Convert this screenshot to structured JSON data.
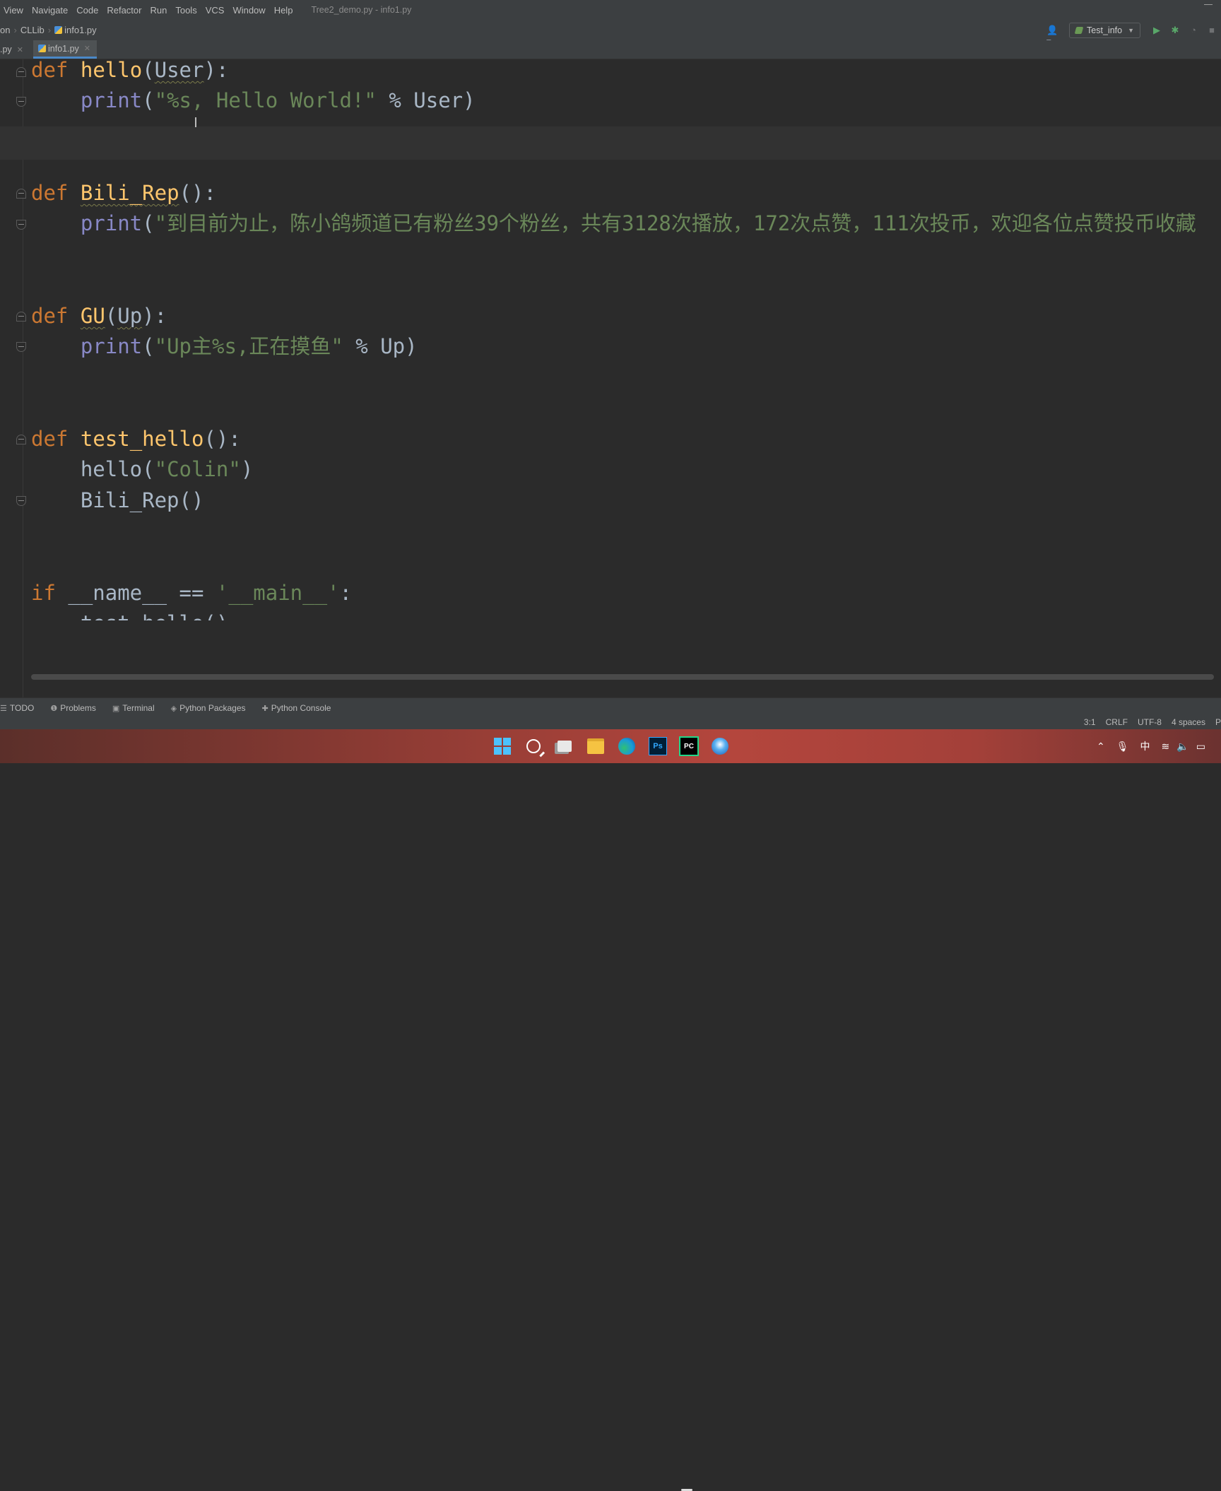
{
  "menu": {
    "items": [
      "View",
      "Navigate",
      "Code",
      "Refactor",
      "Run",
      "Tools",
      "VCS",
      "Window",
      "Help"
    ],
    "title": "Tree2_demo.py - info1.py"
  },
  "nav": {
    "crumb0": "on",
    "crumb1": "CLLib",
    "crumb2": "info1.py",
    "run_config": "Test_info"
  },
  "tabs": {
    "prev": ".py",
    "active": "info1.py"
  },
  "code": {
    "l1": {
      "kw": "def",
      "fn": "hello",
      "p1": "(",
      "param": "User",
      "p2": "):"
    },
    "l2": {
      "bi": "print",
      "p1": "(",
      "str": "\"%s, Hello World!\"",
      "rest": " % User)"
    },
    "l3": {
      "kw": "def",
      "fn": "Bili_Rep",
      "p2": "():"
    },
    "l4": {
      "bi": "print",
      "p1": "(",
      "s1": "\"到目前为止，陈小鸽频道已有粉丝",
      "n1": "39",
      "s2": "个粉丝，共有",
      "n2": "3128",
      "s3": "次播放，",
      "n3": "172",
      "s4": "次点赞，",
      "n4": "111",
      "s5": "次投币，欢迎各位点赞投币收藏"
    },
    "l5": {
      "kw": "def",
      "fn": "GU",
      "p1": "(",
      "param": "Up",
      "p2": "):"
    },
    "l6": {
      "bi": "print",
      "p1": "(",
      "str": "\"Up主%s,正在摸鱼\"",
      "rest": " % Up)"
    },
    "l7": {
      "kw": "def",
      "fn": "test_hello",
      "p2": "():"
    },
    "l8": {
      "a": "hello(",
      "str": "\"Colin\"",
      "b": ")"
    },
    "l9": {
      "a": "Bili_Rep()"
    },
    "l10": {
      "kw": "if",
      "a": " __name__ == ",
      "str": "'__main__'",
      "b": ":"
    },
    "l11": {
      "a": "    test_hello()"
    }
  },
  "tool_windows": [
    "TODO",
    "Problems",
    "Terminal",
    "Python Packages",
    "Python Console"
  ],
  "status": {
    "position": "3:1",
    "line_sep": "CRLF",
    "encoding": "UTF-8",
    "indent": "4 spaces",
    "extra": "P"
  },
  "tray": {
    "ime": "中"
  },
  "colors": {
    "keyword": "#cc7832",
    "function": "#ffc66d",
    "string": "#6a8759",
    "builtin": "#8888c6",
    "text": "#a9b7c6"
  }
}
